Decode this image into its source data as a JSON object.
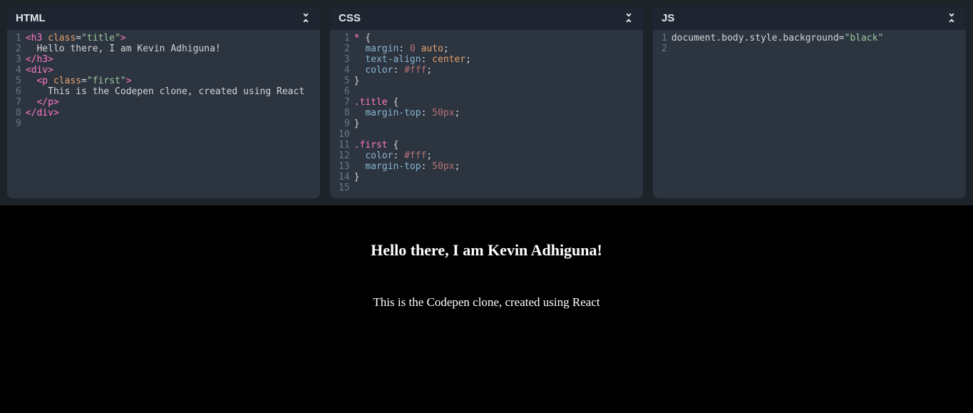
{
  "panes": {
    "html": {
      "title": "HTML",
      "gutter": "1\n2\n3\n4\n5\n6\n7\n8\n9",
      "lines": [
        [
          {
            "c": "tok-tag",
            "t": "<h3"
          },
          {
            "c": "tok-op",
            "t": " "
          },
          {
            "c": "tok-attr",
            "t": "class"
          },
          {
            "c": "tok-op",
            "t": "="
          },
          {
            "c": "tok-string",
            "t": "\"title\""
          },
          {
            "c": "tok-tag",
            "t": ">"
          }
        ],
        [
          {
            "c": "tok-text",
            "t": "  Hello there, I am Kevin Adhiguna!"
          }
        ],
        [
          {
            "c": "tok-tag",
            "t": "</h3>"
          }
        ],
        [
          {
            "c": "tok-tag",
            "t": "<div>"
          }
        ],
        [
          {
            "c": "tok-text",
            "t": "  "
          },
          {
            "c": "tok-tag",
            "t": "<p"
          },
          {
            "c": "tok-op",
            "t": " "
          },
          {
            "c": "tok-attr",
            "t": "class"
          },
          {
            "c": "tok-op",
            "t": "="
          },
          {
            "c": "tok-string",
            "t": "\"first\""
          },
          {
            "c": "tok-tag",
            "t": ">"
          }
        ],
        [
          {
            "c": "tok-text",
            "t": "    This is the Codepen clone, created using React"
          }
        ],
        [
          {
            "c": "tok-text",
            "t": "  "
          },
          {
            "c": "tok-tag",
            "t": "</p>"
          }
        ],
        [
          {
            "c": "tok-tag",
            "t": "</div>"
          }
        ],
        [
          {
            "c": "tok-text",
            "t": ""
          }
        ]
      ]
    },
    "css": {
      "title": "CSS",
      "gutter": " 1\n 2\n 3\n 4\n 5\n 6\n 7\n 8\n 9\n10\n11\n12\n13\n14\n15",
      "lines": [
        [
          {
            "c": "tok-selector",
            "t": "*"
          },
          {
            "c": "tok-punct",
            "t": " {"
          }
        ],
        [
          {
            "c": "tok-text",
            "t": "  "
          },
          {
            "c": "tok-prop",
            "t": "margin"
          },
          {
            "c": "tok-punct",
            "t": ": "
          },
          {
            "c": "tok-num",
            "t": "0"
          },
          {
            "c": "tok-punct",
            "t": " "
          },
          {
            "c": "tok-kw",
            "t": "auto"
          },
          {
            "c": "tok-punct",
            "t": ";"
          }
        ],
        [
          {
            "c": "tok-text",
            "t": "  "
          },
          {
            "c": "tok-prop",
            "t": "text-align"
          },
          {
            "c": "tok-punct",
            "t": ": "
          },
          {
            "c": "tok-kw",
            "t": "center"
          },
          {
            "c": "tok-punct",
            "t": ";"
          }
        ],
        [
          {
            "c": "tok-text",
            "t": "  "
          },
          {
            "c": "tok-prop",
            "t": "color"
          },
          {
            "c": "tok-punct",
            "t": ": "
          },
          {
            "c": "tok-num",
            "t": "#fff"
          },
          {
            "c": "tok-punct",
            "t": ";"
          }
        ],
        [
          {
            "c": "tok-punct",
            "t": "}"
          }
        ],
        [
          {
            "c": "tok-text",
            "t": ""
          }
        ],
        [
          {
            "c": "tok-selector",
            "t": ".title"
          },
          {
            "c": "tok-punct",
            "t": " {"
          }
        ],
        [
          {
            "c": "tok-text",
            "t": "  "
          },
          {
            "c": "tok-prop",
            "t": "margin-top"
          },
          {
            "c": "tok-punct",
            "t": ": "
          },
          {
            "c": "tok-num",
            "t": "50px"
          },
          {
            "c": "tok-punct",
            "t": ";"
          }
        ],
        [
          {
            "c": "tok-punct",
            "t": "}"
          }
        ],
        [
          {
            "c": "tok-text",
            "t": ""
          }
        ],
        [
          {
            "c": "tok-selector",
            "t": ".first"
          },
          {
            "c": "tok-punct",
            "t": " {"
          }
        ],
        [
          {
            "c": "tok-text",
            "t": "  "
          },
          {
            "c": "tok-prop",
            "t": "color"
          },
          {
            "c": "tok-punct",
            "t": ": "
          },
          {
            "c": "tok-num",
            "t": "#fff"
          },
          {
            "c": "tok-punct",
            "t": ";"
          }
        ],
        [
          {
            "c": "tok-text",
            "t": "  "
          },
          {
            "c": "tok-prop",
            "t": "margin-top"
          },
          {
            "c": "tok-punct",
            "t": ": "
          },
          {
            "c": "tok-num",
            "t": "50px"
          },
          {
            "c": "tok-punct",
            "t": ";"
          }
        ],
        [
          {
            "c": "tok-punct",
            "t": "}"
          }
        ],
        [
          {
            "c": "tok-text",
            "t": ""
          }
        ]
      ]
    },
    "js": {
      "title": "JS",
      "gutter": "1\n2",
      "lines": [
        [
          {
            "c": "tok-ident",
            "t": "document"
          },
          {
            "c": "tok-dot",
            "t": "."
          },
          {
            "c": "tok-ident",
            "t": "body"
          },
          {
            "c": "tok-dot",
            "t": "."
          },
          {
            "c": "tok-ident",
            "t": "style"
          },
          {
            "c": "tok-dot",
            "t": "."
          },
          {
            "c": "tok-ident",
            "t": "background"
          },
          {
            "c": "tok-op",
            "t": "="
          },
          {
            "c": "tok-string",
            "t": "\"black\""
          }
        ],
        [
          {
            "c": "tok-text",
            "t": ""
          }
        ]
      ]
    }
  },
  "preview": {
    "heading": "Hello there, I am Kevin Adhiguna!",
    "subheading": "This is the Codepen clone, created using React"
  },
  "icons": {
    "collapse": "compress-icon"
  }
}
